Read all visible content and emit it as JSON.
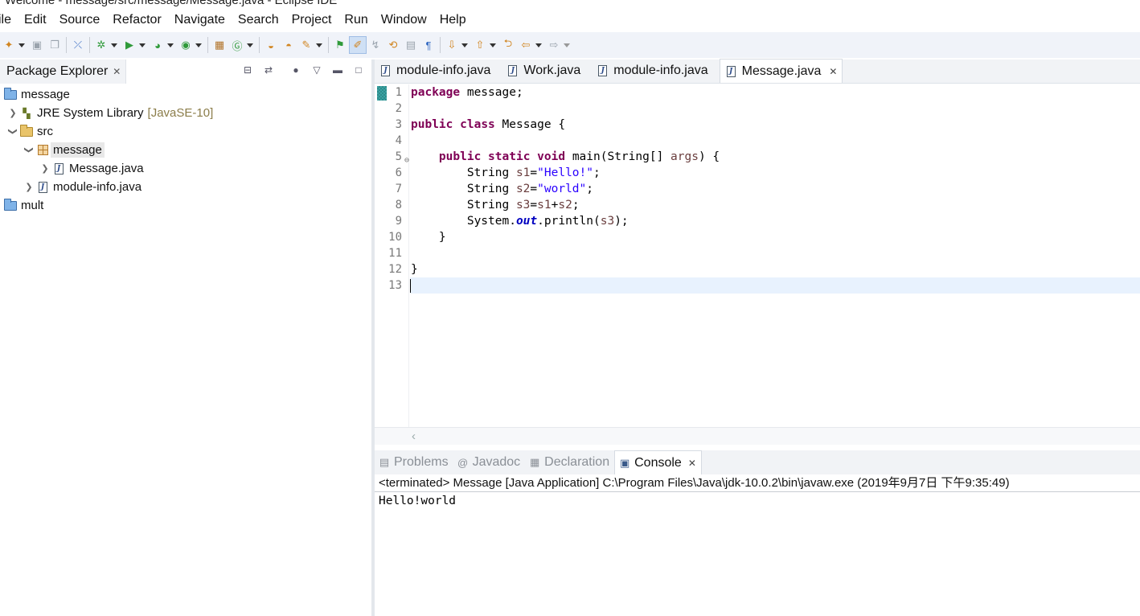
{
  "window": {
    "title": "Welcome - message/src/message/Message.java - Eclipse IDE"
  },
  "menu": [
    "ile",
    "Edit",
    "Source",
    "Refactor",
    "Navigate",
    "Search",
    "Project",
    "Run",
    "Window",
    "Help"
  ],
  "explorer": {
    "title": "Package Explorer",
    "tree": {
      "project": "message",
      "jre": "JRE System Library",
      "jre_decoration": "[JavaSE-10]",
      "src": "src",
      "package": "message",
      "file1": "Message.java",
      "file2": "module-info.java",
      "project2": "mult"
    }
  },
  "editor": {
    "tabs": [
      "module-info.java",
      "Work.java",
      "module-info.java",
      "Message.java"
    ],
    "active_tab": "Message.java",
    "line_numbers": [
      "1",
      "2",
      "3",
      "4",
      "5",
      "6",
      "7",
      "8",
      "9",
      "10",
      "11",
      "12",
      "13"
    ]
  },
  "console": {
    "tabs": [
      "Problems",
      "Javadoc",
      "Declaration",
      "Console"
    ],
    "status": "<terminated> Message [Java Application] C:\\Program Files\\Java\\jdk-10.0.2\\bin\\javaw.exe (2019年9月7日 下午9:35:49)",
    "output": "Hello!world"
  },
  "colors": {
    "keyword": "#7f0055",
    "string": "#2a00ff",
    "static_field": "#0000c0",
    "current_line": "#e8f2fe",
    "toolbar_bg": "#f0f3f9"
  }
}
